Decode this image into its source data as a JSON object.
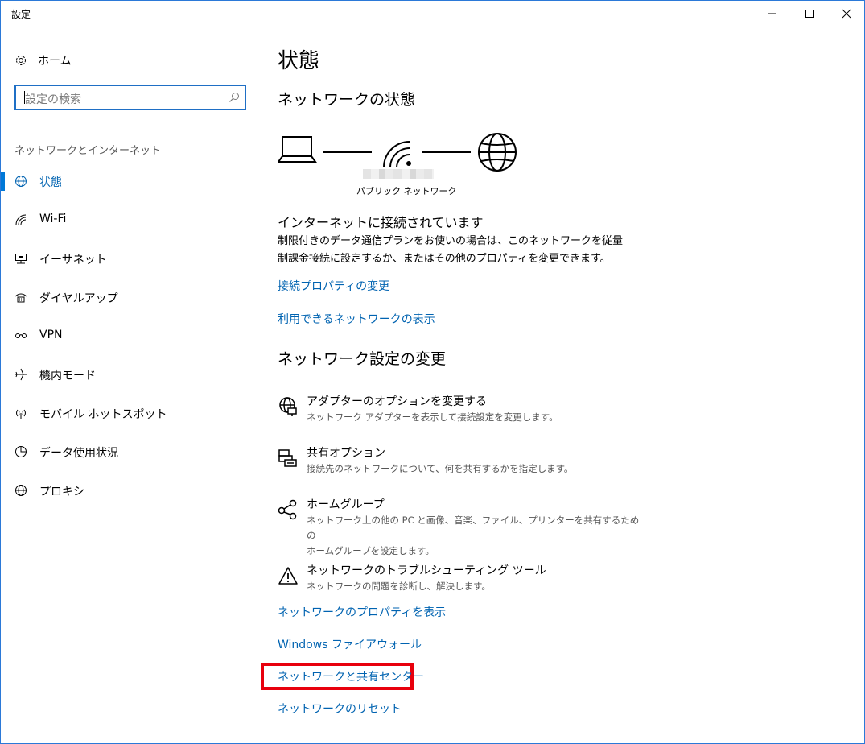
{
  "window": {
    "title": "設定"
  },
  "sidebar": {
    "home_label": "ホーム",
    "search_placeholder": "設定の検索",
    "group_label": "ネットワークとインターネット",
    "items": [
      {
        "label": "状態",
        "icon": "globe-status-icon",
        "active": true
      },
      {
        "label": "Wi-Fi",
        "icon": "wifi-icon",
        "active": false
      },
      {
        "label": "イーサネット",
        "icon": "ethernet-icon",
        "active": false
      },
      {
        "label": "ダイヤルアップ",
        "icon": "dialup-icon",
        "active": false
      },
      {
        "label": "VPN",
        "icon": "vpn-icon",
        "active": false
      },
      {
        "label": "機内モード",
        "icon": "airplane-icon",
        "active": false
      },
      {
        "label": "モバイル ホットスポット",
        "icon": "hotspot-icon",
        "active": false
      },
      {
        "label": "データ使用状況",
        "icon": "data-usage-icon",
        "active": false
      },
      {
        "label": "プロキシ",
        "icon": "proxy-globe-icon",
        "active": false
      }
    ]
  },
  "main": {
    "title": "状態",
    "network_status_heading": "ネットワークの状態",
    "network_label": "パブリック ネットワーク",
    "connected_title": "インターネットに接続されています",
    "connected_desc_line1": "制限付きのデータ通信プランをお使いの場合は、このネットワークを従量",
    "connected_desc_line2": "制課金接続に設定するか、またはその他のプロパティを変更できます。",
    "link_change_props": "接続プロパティの変更",
    "link_show_networks": "利用できるネットワークの表示",
    "change_settings_heading": "ネットワーク設定の変更",
    "options": [
      {
        "title": "アダプターのオプションを変更する",
        "desc": "ネットワーク アダプターを表示して接続設定を変更します。",
        "icon": "adapter-icon"
      },
      {
        "title": "共有オプション",
        "desc": "接続先のネットワークについて、何を共有するかを指定します。",
        "icon": "sharing-icon"
      },
      {
        "title": "ホームグループ",
        "desc_line1": "ネットワーク上の他の PC と画像、音楽、ファイル、プリンターを共有するための",
        "desc_line2": "ホームグループを設定します。",
        "icon": "homegroup-icon"
      },
      {
        "title": "ネットワークのトラブルシューティング ツール",
        "desc": "ネットワークの問題を診断し、解決します。",
        "icon": "warning-icon"
      }
    ],
    "link_view_props": "ネットワークのプロパティを表示",
    "link_firewall": "Windows ファイアウォール",
    "link_sharing_center": "ネットワークと共有センター",
    "link_reset": "ネットワークのリセット"
  },
  "colors": {
    "accent": "#0078d7",
    "link": "#0063b1",
    "highlight": "#e8000d",
    "border": "#2b79d8"
  }
}
